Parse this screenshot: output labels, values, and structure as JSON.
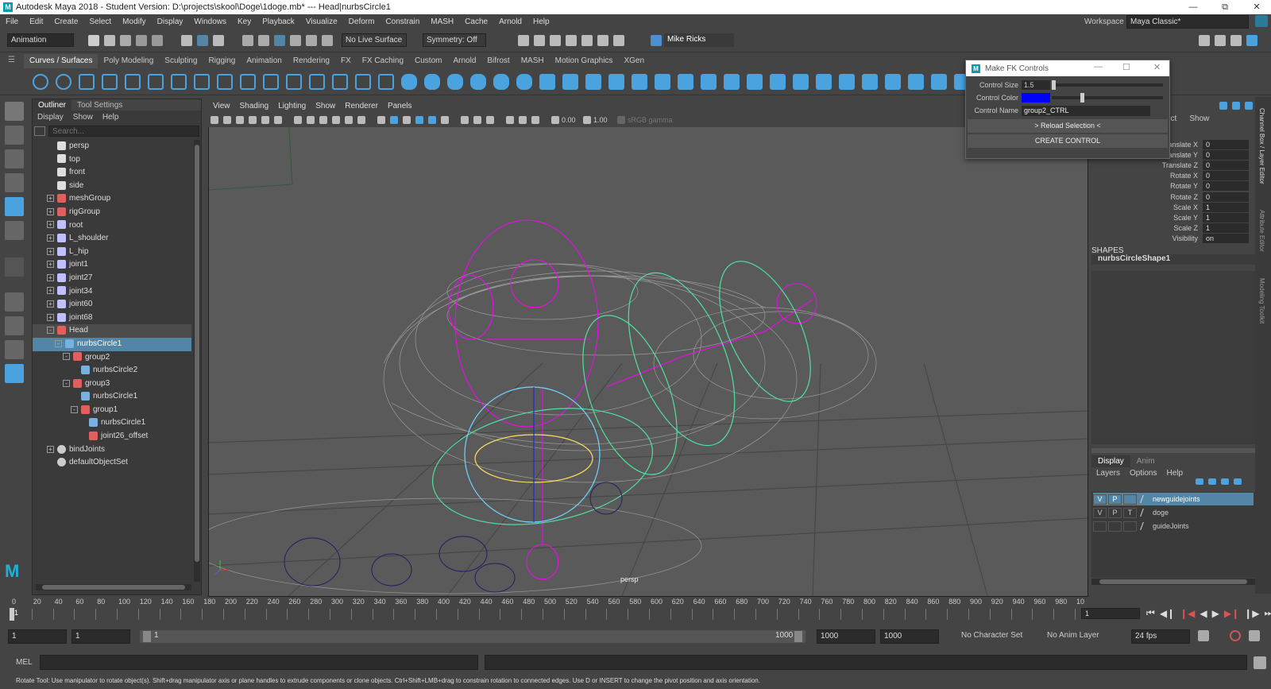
{
  "title": "Autodesk Maya 2018 - Student Version: D:\\projects\\skool\\Doge\\1doge.mb*  ---  Head|nurbsCircle1",
  "logo": "M",
  "menus": [
    "File",
    "Edit",
    "Create",
    "Select",
    "Modify",
    "Display",
    "Windows",
    "Key",
    "Playback",
    "Visualize",
    "Deform",
    "Constrain",
    "MASH",
    "Cache",
    "Arnold",
    "Help"
  ],
  "workspace": {
    "label": "Workspace :",
    "value": "Maya Classic*"
  },
  "status": {
    "mode": "Animation",
    "live_surface": "No Live Surface",
    "symmetry": "Symmetry: Off",
    "user": "Mike Ricks"
  },
  "shelf_tabs": [
    "Curves / Surfaces",
    "Poly Modeling",
    "Sculpting",
    "Rigging",
    "Animation",
    "Rendering",
    "FX",
    "FX Caching",
    "Custom",
    "Arnold",
    "Bifrost",
    "MASH",
    "Motion Graphics",
    "XGen"
  ],
  "outliner": {
    "tabs": [
      "Outliner",
      "Tool Settings"
    ],
    "menus": [
      "Display",
      "Show",
      "Help"
    ],
    "search_placeholder": "Search...",
    "items": [
      {
        "label": "persp",
        "depth": 0,
        "expander": "",
        "icon": "camera-icon"
      },
      {
        "label": "top",
        "depth": 0,
        "expander": "",
        "icon": "camera-icon"
      },
      {
        "label": "front",
        "depth": 0,
        "expander": "",
        "icon": "camera-icon"
      },
      {
        "label": "side",
        "depth": 0,
        "expander": "",
        "icon": "camera-icon"
      },
      {
        "label": "meshGroup",
        "depth": 0,
        "expander": "+",
        "icon": "group-icon"
      },
      {
        "label": "rigGroup",
        "depth": 0,
        "expander": "+",
        "icon": "group-icon"
      },
      {
        "label": "root",
        "depth": 0,
        "expander": "+",
        "icon": "joint-icon"
      },
      {
        "label": "L_shoulder",
        "depth": 0,
        "expander": "+",
        "icon": "joint-icon"
      },
      {
        "label": "L_hip",
        "depth": 0,
        "expander": "+",
        "icon": "joint-icon"
      },
      {
        "label": "joint1",
        "depth": 0,
        "expander": "+",
        "icon": "joint-icon"
      },
      {
        "label": "joint27",
        "depth": 0,
        "expander": "+",
        "icon": "joint-icon"
      },
      {
        "label": "joint34",
        "depth": 0,
        "expander": "+",
        "icon": "joint-icon"
      },
      {
        "label": "joint60",
        "depth": 0,
        "expander": "+",
        "icon": "joint-icon"
      },
      {
        "label": "joint68",
        "depth": 0,
        "expander": "+",
        "icon": "joint-icon"
      },
      {
        "label": "Head",
        "depth": 0,
        "expander": "-",
        "icon": "group-icon",
        "hl": true
      },
      {
        "label": "nurbsCircle1",
        "depth": 1,
        "expander": "-",
        "icon": "curve-icon",
        "sel": true
      },
      {
        "label": "group2",
        "depth": 2,
        "expander": "-",
        "icon": "group-icon"
      },
      {
        "label": "nurbsCircle2",
        "depth": 3,
        "expander": "",
        "icon": "curve-icon"
      },
      {
        "label": "group3",
        "depth": 2,
        "expander": "-",
        "icon": "group-icon"
      },
      {
        "label": "nurbsCircle1",
        "depth": 3,
        "expander": "",
        "icon": "curve-icon"
      },
      {
        "label": "group1",
        "depth": 3,
        "expander": "-",
        "icon": "group-icon"
      },
      {
        "label": "nurbsCircle1",
        "depth": 4,
        "expander": "",
        "icon": "curve-icon"
      },
      {
        "label": "joint26_offset",
        "depth": 4,
        "expander": "",
        "icon": "group-icon"
      },
      {
        "label": "bindJoints",
        "depth": 0,
        "expander": "+",
        "icon": "set-icon"
      },
      {
        "label": "defaultObjectSet",
        "depth": 0,
        "expander": "",
        "icon": "set-icon"
      }
    ]
  },
  "viewport": {
    "menus": [
      "View",
      "Shading",
      "Lighting",
      "Show",
      "Renderer",
      "Panels"
    ],
    "near": "0.00",
    "far": "1.00",
    "colorspace": "sRGB gamma",
    "camera": "persp"
  },
  "fk_window": {
    "title": "Make FK Controls",
    "size_label": "Control Size",
    "size_value": "1.5",
    "color_label": "Control Color",
    "color": "#0000ff",
    "name_label": "Control Name",
    "name_value": "group2_CTRL",
    "reload_label": "> Reload Selection <",
    "create_label": "CREATE CONTROL"
  },
  "channel_box": {
    "menus": [
      "ect",
      "Show"
    ],
    "channels": [
      {
        "label": "Translate X",
        "value": "0"
      },
      {
        "label": "Translate Y",
        "value": "0"
      },
      {
        "label": "Translate Z",
        "value": "0"
      },
      {
        "label": "Rotate X",
        "value": "0"
      },
      {
        "label": "Rotate Y",
        "value": "0"
      },
      {
        "label": "Rotate Z",
        "value": "0"
      },
      {
        "label": "Scale X",
        "value": "1"
      },
      {
        "label": "Scale Y",
        "value": "1"
      },
      {
        "label": "Scale Z",
        "value": "1"
      },
      {
        "label": "Visibility",
        "value": "on"
      }
    ],
    "shapes_label": "SHAPES",
    "shape_name": "nurbsCircleShape1",
    "side_tabs": [
      "Channel Box / Layer Editor",
      "Attribute Editor",
      "Modeling Toolkit"
    ]
  },
  "layer_editor": {
    "tabs": [
      "Display",
      "Anim"
    ],
    "menus": [
      "Layers",
      "Options",
      "Help"
    ],
    "layers": [
      {
        "v": "V",
        "p": "P",
        "t": "",
        "name": "newguidejoints",
        "sel": true
      },
      {
        "v": "V",
        "p": "P",
        "t": "T",
        "name": "doge",
        "sel": false
      },
      {
        "v": "",
        "p": "",
        "t": "",
        "name": "guideJoints",
        "sel": false
      }
    ]
  },
  "timeline": {
    "ticks": [
      "0",
      "20",
      "40",
      "60",
      "80",
      "100",
      "120",
      "140",
      "160",
      "180",
      "200",
      "220",
      "240",
      "260",
      "280",
      "300",
      "320",
      "340",
      "360",
      "380",
      "400",
      "420",
      "440",
      "460",
      "480",
      "500",
      "520",
      "540",
      "560",
      "580",
      "600",
      "620",
      "640",
      "660",
      "680",
      "700",
      "720",
      "740",
      "760",
      "780",
      "800",
      "820",
      "840",
      "860",
      "880",
      "900",
      "920",
      "940",
      "960",
      "980",
      "10"
    ],
    "current": "1",
    "frame_field": "1"
  },
  "range": {
    "start": "1",
    "anim_start": "1",
    "slider_start": "1",
    "slider_end": "1000",
    "end": "1000",
    "anim_end": "1000",
    "char_set": "No Character Set",
    "anim_layer": "No Anim Layer",
    "fps": "24 fps"
  },
  "cmd": {
    "label": "MEL"
  },
  "help": "Rotate Tool: Use manipulator to rotate object(s). Shift+drag manipulator axis or plane handles to extrude components or clone objects. Ctrl+Shift+LMB+drag to constrain rotation to connected edges. Use D or INSERT to change the pivot position and axis orientation.",
  "colors": {
    "accent": "#5285a6",
    "shelf_icon": "#4aa3df",
    "selection_magenta": "#ff00ff",
    "curve_green": "#50e0a0"
  }
}
